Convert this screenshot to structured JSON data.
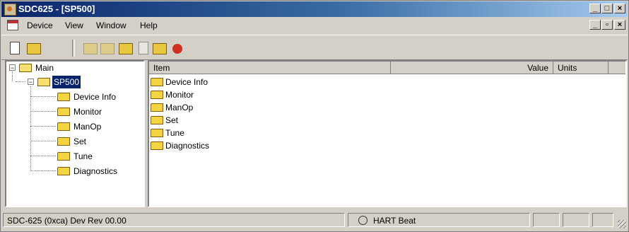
{
  "window": {
    "title": "SDC625 - [SP500]",
    "caption_buttons": {
      "minimize": "_",
      "maximize": "□",
      "close": "×"
    }
  },
  "menubar": {
    "items": [
      {
        "label": "Device",
        "accel": "D"
      },
      {
        "label": "View",
        "accel": "V"
      },
      {
        "label": "Window",
        "accel": "W"
      },
      {
        "label": "Help",
        "accel": "H"
      }
    ],
    "child_controls": {
      "minimize": "_",
      "restore": "▫",
      "close": "×"
    }
  },
  "toolbar": {
    "buttons": [
      "new-doc-icon",
      "open-folder-icon",
      "disabled-tool-icon",
      "disabled-tool-icon",
      "folder-arrow-icon",
      "print-icon",
      "folder-refresh-icon",
      "folder-stop-icon"
    ]
  },
  "tree": {
    "root": "Main",
    "device": "SP500",
    "children": [
      "Device Info",
      "Monitor",
      "ManOp",
      "Set",
      "Tune",
      "Diagnostics"
    ],
    "expander_open": "−"
  },
  "list": {
    "columns": {
      "item": "Item",
      "value": "Value",
      "units": "Units"
    },
    "rows": [
      "Device Info",
      "Monitor",
      "ManOp",
      "Set",
      "Tune",
      "Diagnostics"
    ]
  },
  "status": {
    "device": "SDC-625   (0xca)  Dev Rev 00.00",
    "heartbeat": "HART Beat"
  },
  "colors": {
    "title_gradient_start": "#0a246a",
    "title_gradient_end": "#a6caf0",
    "folder_yellow": "#f4d440",
    "selection": "#0a246a"
  }
}
